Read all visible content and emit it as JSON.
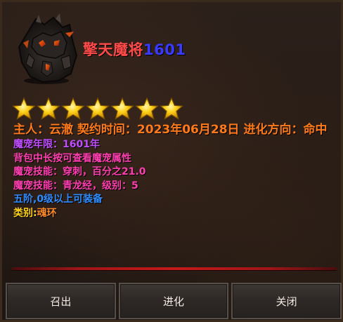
{
  "pet": {
    "name": "擎天魔将",
    "number": "1601",
    "star_count": 7
  },
  "info": {
    "owner_line": "主人：云澈 契约时间：2023年06月28日 进化方向：命中",
    "lifespan": "魔宠年限：1601年",
    "hint": "背包中长按可查看魔宠属性",
    "skill_1": "魔宠技能：穿刺，百分之21.0",
    "skill_2": "魔宠技能：青龙经，级别：5",
    "equip_req": "五阶,0级以上可装备",
    "category_label": "类别:",
    "category_value": "魂环"
  },
  "buttons": {
    "summon": "召出",
    "evolve": "进化",
    "close": "关闭"
  },
  "colors": {
    "name": "#ff4a4a",
    "number": "#3a3aff",
    "owner": "#ff7a1a",
    "lifespan": "#c04dff",
    "skill": "#ff3fb0",
    "equip": "#2f8dff",
    "category_label": "#ffd21a",
    "category_value": "#ff8a2a",
    "divider": "#c41a1a"
  }
}
